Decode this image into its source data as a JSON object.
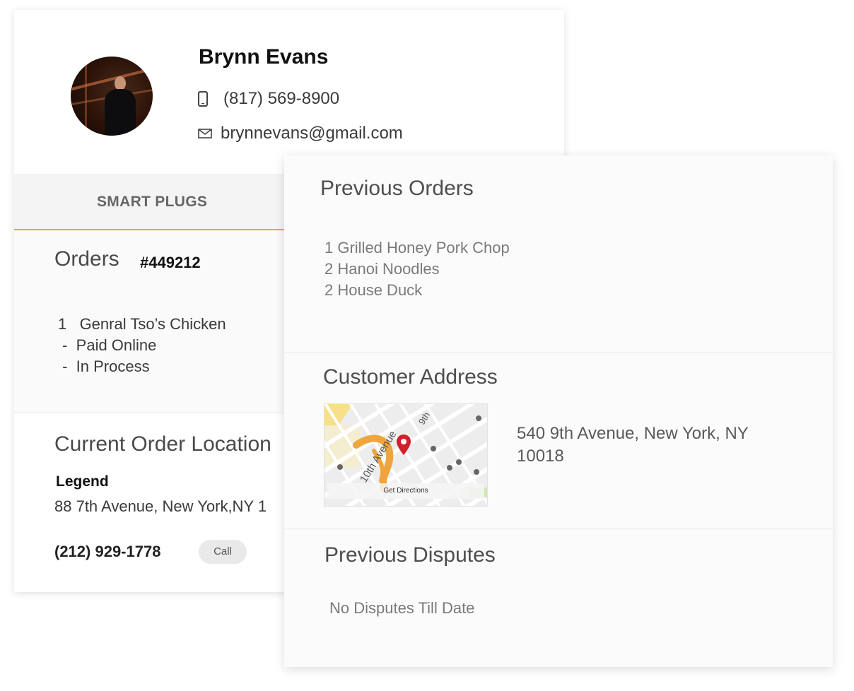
{
  "profile": {
    "name": "Brynn Evans",
    "phone": "(817) 569-8900",
    "email": "brynnevans@gmail.com"
  },
  "tabs": {
    "active_label": "SMART PLUGS",
    "accent_color": "#f0a43c"
  },
  "orders": {
    "title": "Orders",
    "order_number": "#449212",
    "lines": [
      "1   Genral Tso’s Chicken",
      " -  Paid Online",
      " -  In Process"
    ]
  },
  "location": {
    "title": "Current Order Location",
    "legend_label": "Legend",
    "address": "88 7th Avenue, New York,NY 1",
    "phone": "(212) 929-1778",
    "call_label": "Call"
  },
  "previous_orders": {
    "title": "Previous Orders",
    "items": [
      "1 Grilled Honey Pork Chop",
      "2 Hanoi Noodles",
      "2 House Duck"
    ]
  },
  "customer_address": {
    "title": "Customer Address",
    "map_caption": "Get Directions",
    "map_street_labels": [
      "10th Avenue",
      "9th"
    ],
    "address": "540 9th Avenue, New York, NY 10018"
  },
  "previous_disputes": {
    "title": "Previous Disputes",
    "status": "No Disputes Till Date"
  },
  "icons": {
    "phone": "phone-icon",
    "email": "mail-icon",
    "map_pin": "map-pin-icon"
  }
}
